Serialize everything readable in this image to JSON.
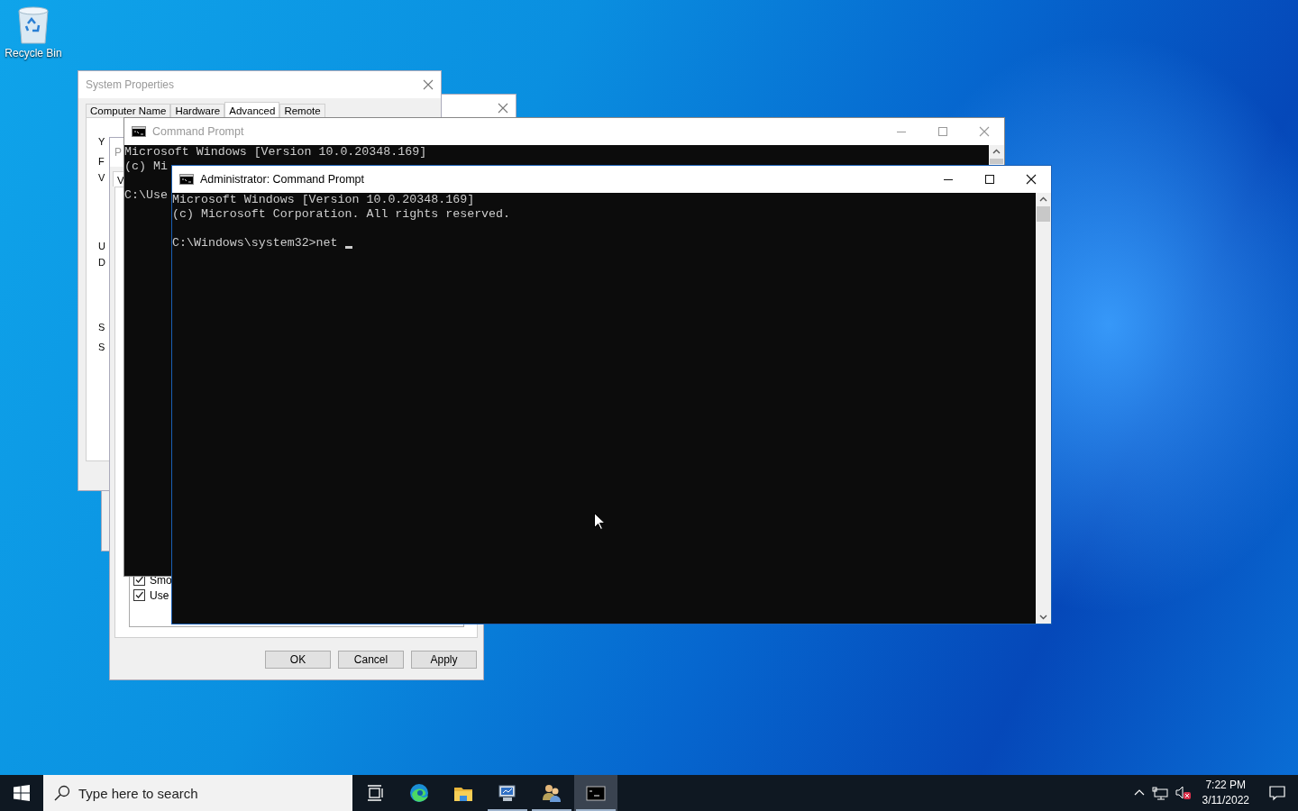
{
  "desktop": {
    "icons": [
      {
        "label": "Recycle Bin"
      }
    ]
  },
  "system_properties": {
    "title": "System Properties",
    "tabs": [
      {
        "label": "Computer Name",
        "selected": false
      },
      {
        "label": "Hardware",
        "selected": false
      },
      {
        "label": "Advanced",
        "selected": true
      },
      {
        "label": "Remote",
        "selected": false
      }
    ],
    "fragments": [
      "Y",
      "F",
      "V",
      "U",
      "D",
      "S",
      "S"
    ]
  },
  "performance_options": {
    "title": "P",
    "tab": "V",
    "checkboxes": [
      {
        "label": "Smo",
        "checked": true
      },
      {
        "label": "Use",
        "checked": true
      }
    ],
    "buttons": [
      "OK",
      "Cancel",
      "Apply"
    ]
  },
  "consoles": [
    {
      "title": "Command Prompt",
      "active": false,
      "paragraphs": [
        [
          "Microsoft Windows [Version 10.0.20348.169]",
          "(c) Mi"
        ],
        [
          "C:\\Use"
        ]
      ]
    },
    {
      "title": "Administrator: Command Prompt",
      "active": true,
      "cursor": true,
      "paragraphs": [
        [
          "Microsoft Windows [Version 10.0.20348.169]",
          "(c) Microsoft Corporation. All rights reserved."
        ],
        [
          "C:\\Windows\\system32>net"
        ]
      ]
    }
  ],
  "taskbar": {
    "search": {
      "placeholder": "Type here to search"
    },
    "apps": [
      {
        "kind": "task_view",
        "running": false,
        "active": false
      },
      {
        "kind": "browser",
        "running": false,
        "active": false
      },
      {
        "kind": "files",
        "running": false,
        "active": false
      },
      {
        "kind": "server_manager",
        "running": true,
        "active": false
      },
      {
        "kind": "users",
        "running": true,
        "active": false
      },
      {
        "kind": "console",
        "running": true,
        "active": true
      }
    ],
    "clock": {
      "time": "7:22 PM",
      "date": "3/11/2022"
    }
  }
}
